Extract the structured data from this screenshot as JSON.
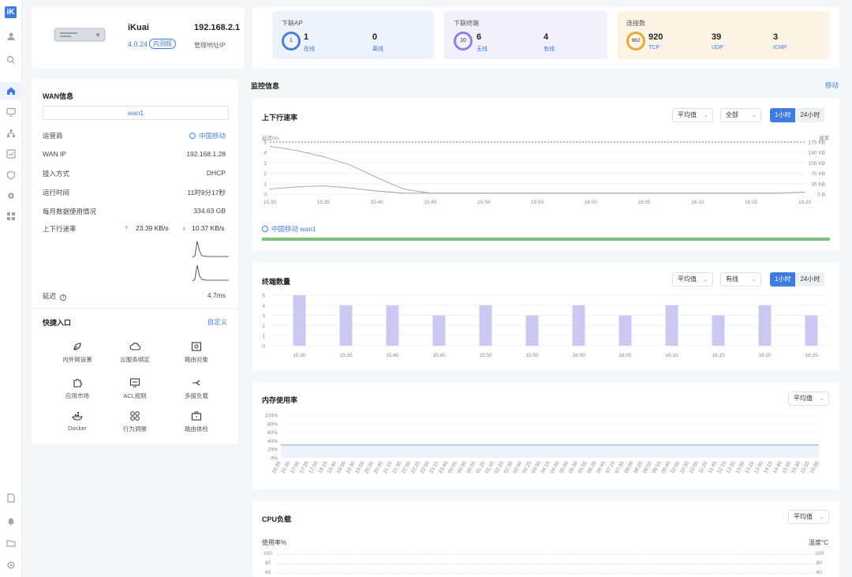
{
  "sidebar": {
    "logo": "iK",
    "icons": [
      "user-icon",
      "search-icon",
      "home-icon",
      "monitor-icon",
      "network-icon",
      "chart-icon",
      "shield-icon",
      "gear-icon",
      "apps-icon",
      "doc-icon",
      "bell-icon",
      "folder-icon",
      "settings-icon"
    ]
  },
  "device": {
    "name": "iKuai",
    "version": "4.0.24",
    "badge": "内测版",
    "ip": "192.168.2.1",
    "ip_label": "管理地址IP"
  },
  "stats": {
    "ap": {
      "title": "下联AP",
      "ring": "1",
      "online_val": "1",
      "online_label": "在线",
      "abnormal_val": "0",
      "abnormal_label": "离线"
    },
    "terminal": {
      "title": "下联终端",
      "ring": "10",
      "wireless_val": "6",
      "wireless_label": "无线",
      "wired_val": "4",
      "wired_label": "有线"
    },
    "conn": {
      "title": "连接数",
      "ring": "962",
      "tcp_val": "920",
      "tcp_label": "TCP",
      "udp_val": "39",
      "udp_label": "UDP",
      "icmp_val": "3",
      "icmp_label": "ICMP"
    }
  },
  "wan": {
    "title": "WAN信息",
    "tab": "wan1",
    "rows": [
      {
        "key": "运营商",
        "value": "中国移动"
      },
      {
        "key": "WAN IP",
        "value": "192.168.1.28"
      },
      {
        "key": "接入方式",
        "value": "DHCP"
      },
      {
        "key": "运行时间",
        "value": "11时9分17秒"
      },
      {
        "key": "每月数据使用情况",
        "value": "334.63 GB"
      }
    ],
    "speed_label": "上下行速率",
    "up": "23.39 KB/s",
    "down": "10.37 KB/s",
    "latency_label": "延迟",
    "latency_value": "4.7ms"
  },
  "quick": {
    "title": "快捷入口",
    "customize": "自定义",
    "items": [
      "内外网设置",
      "云服务绑定",
      "路由对象",
      "应用市场",
      "ACL规则",
      "多拨负载",
      "Docker",
      "行为洞察",
      "路由体检"
    ]
  },
  "monitor": {
    "title": "监控信息",
    "more": "移动"
  },
  "speed_chart": {
    "title": "上下行速率",
    "sel1": "平均值",
    "sel2": "全部",
    "t1": "1小时",
    "t2": "24小时",
    "left_unit": "延迟ms",
    "right_unit": "速率",
    "legend": "中国移动 wan1"
  },
  "term_chart": {
    "title": "终端数量",
    "sel1": "平均值",
    "sel2": "有线",
    "t1": "1小时",
    "t2": "24小时"
  },
  "mem_chart": {
    "title": "内存使用率",
    "sel1": "平均值"
  },
  "cpu_chart": {
    "title": "CPU负载",
    "sel1": "平均值",
    "left_unit": "使用率%",
    "right_unit": "温度°C",
    "left_ticks": [
      "100",
      "80",
      "60"
    ],
    "right_ticks": [
      "100",
      "80",
      "60"
    ]
  },
  "chart_data": [
    {
      "type": "line",
      "title": "上下行速率",
      "x": [
        "15:30",
        "15:35",
        "15:40",
        "15:45",
        "15:50",
        "15:55",
        "16:00",
        "16:05",
        "16:10",
        "16:15",
        "16:20"
      ],
      "left_ticks": [
        "0",
        "1",
        "2",
        "3",
        "4",
        "5"
      ],
      "right_ticks": [
        "0 B",
        "35 KB",
        "70 KB",
        "105 KB",
        "140 KB",
        "175 KB"
      ],
      "series": [
        {
          "values": [
            4.6,
            4.2,
            3.6,
            2.8,
            1.6,
            0.5,
            0.1,
            0.1,
            0.1,
            0.1,
            0.1,
            0.1,
            0.1,
            0.1,
            0.1,
            0.1,
            0.1,
            0.1,
            0.1,
            0.1,
            0.2
          ]
        },
        {
          "values": [
            0.5,
            0.7,
            0.8,
            0.6,
            0.3,
            0.1,
            0.1,
            0.1,
            0.1,
            0.1,
            0.1,
            0.1,
            0.1,
            0.1,
            0.1,
            0.1,
            0.1,
            0.1,
            0.1,
            0.1,
            0.2
          ]
        },
        {
          "values": [
            5,
            5,
            5,
            5,
            5,
            5,
            5,
            5,
            5,
            5,
            5,
            5,
            5,
            5,
            5,
            5,
            5,
            5,
            5,
            5,
            5
          ]
        }
      ],
      "ylim": [
        0,
        5
      ]
    },
    {
      "type": "bar",
      "title": "终端数量",
      "categories": [
        "15:30",
        "15:35",
        "15:40",
        "15:45",
        "15:50",
        "15:55",
        "16:00",
        "16:05",
        "16:10",
        "16:15",
        "16:20",
        "16:25"
      ],
      "values": [
        5,
        4,
        4,
        3,
        4,
        3,
        4,
        3,
        4,
        3,
        4,
        3
      ],
      "left_ticks": [
        "0",
        "1",
        "2",
        "3",
        "4",
        "5"
      ],
      "ylim": [
        0,
        5
      ]
    },
    {
      "type": "line",
      "title": "内存使用率",
      "left_ticks": [
        "0%",
        "20%",
        "40%",
        "60%",
        "80%",
        "100%"
      ],
      "x": [
        "16:20",
        "16:35",
        "17:00",
        "17:25",
        "17:50",
        "18:15",
        "18:40",
        "19:05",
        "19:30",
        "19:55",
        "20:20",
        "20:45",
        "21:10",
        "21:35",
        "22:00",
        "22:25",
        "22:50",
        "23:15",
        "23:40",
        "00:05",
        "00:30",
        "00:55",
        "01:20",
        "01:45",
        "02:10",
        "02:35",
        "03:00",
        "03:25",
        "03:50",
        "04:15",
        "04:40",
        "05:05",
        "05:30",
        "05:55",
        "06:20",
        "06:45",
        "07:10",
        "07:35",
        "08:00",
        "08:25",
        "08:50",
        "09:15",
        "09:40",
        "10:05",
        "10:30",
        "10:55",
        "11:20",
        "11:45",
        "12:10",
        "12:35",
        "13:00",
        "13:25",
        "13:50",
        "14:15",
        "14:40",
        "15:05",
        "15:30",
        "15:55",
        "16:20"
      ],
      "values_pct": 30,
      "ylim": [
        0,
        100
      ]
    }
  ]
}
